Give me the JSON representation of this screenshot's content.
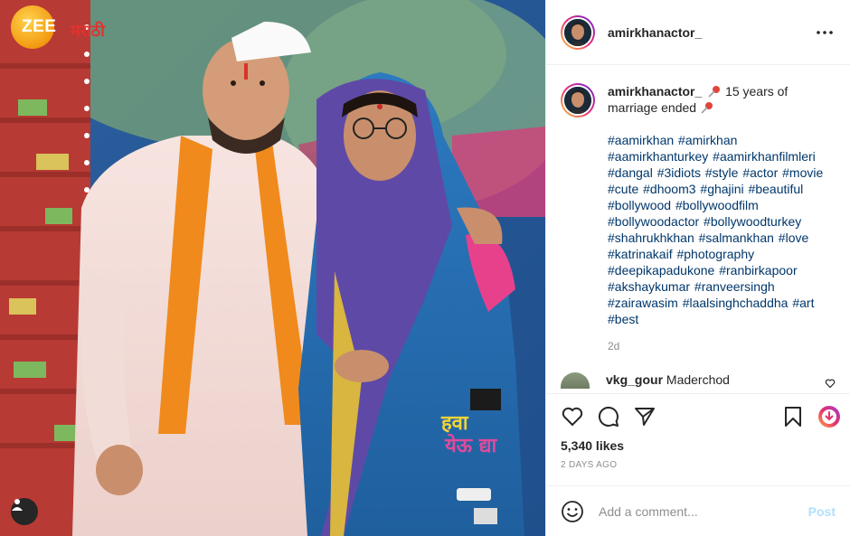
{
  "media": {
    "watermark": {
      "brand": "ZEE",
      "brand_suffix": "मराठी"
    },
    "user_tag_icon": "user-icon"
  },
  "header": {
    "username": "amirkhanactor_",
    "more_icon": "more-horizontal-icon"
  },
  "caption": {
    "username": "amirkhanactor_",
    "text_part1": "15 years of marriage ended",
    "pin_icon": "pushpin-icon",
    "hashtags": "#aamirkhan #amirkhan #aamirkhanturkey #aamirkhanfilmleri #dangal #3idiots #style #actor #movie #cute #dhoom3 #ghajini #beautiful #bollywood #bollywoodfilm #bollywoodactor #bollywoodturkey #shahrukhkhan #salmankhan #love #katrinakaif #photography #deepikapadukone #ranbirkapoor #akshaykumar #ranveersingh #zairawasim #laalsinghchaddha #art #best",
    "time": "2d"
  },
  "comment": {
    "username": "vkg_gour",
    "text": "Maderchod"
  },
  "actions": {
    "like_icon": "heart-icon",
    "comment_icon": "comment-icon",
    "share_icon": "send-icon",
    "save_icon": "bookmark-icon",
    "extra_icon": "download-circle-icon"
  },
  "likes_text": "5,340 likes",
  "date_text": "2 DAYS AGO",
  "add_comment": {
    "placeholder": "Add a comment...",
    "post_label": "Post",
    "emoji_icon": "smiley-icon"
  },
  "colors": {
    "link": "#00376b",
    "post_disabled": "#b2dffc",
    "muted": "#8e8e8e"
  }
}
